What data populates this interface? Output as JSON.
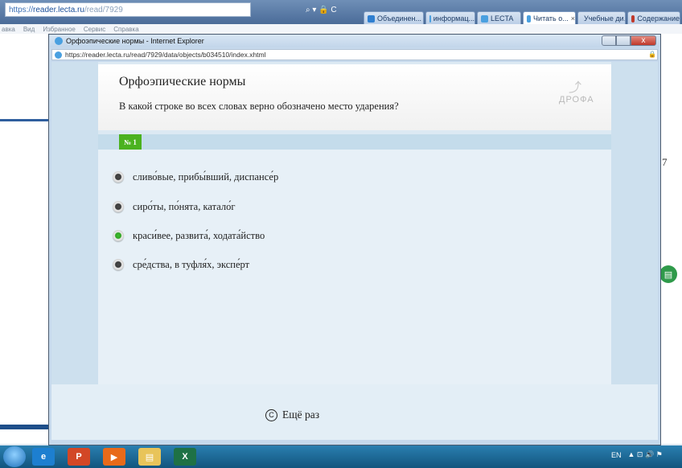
{
  "browser": {
    "address_host": "https://",
    "address_domain": "reader.lecta.ru",
    "address_path": "/read/7929",
    "address_ctrls": "⌕ ▾ 🔒 C",
    "tabs": [
      {
        "label": "Объединен...",
        "color": "#2f7fd0"
      },
      {
        "label": "информац...",
        "color": "#4aa0e0"
      },
      {
        "label": "LECTA",
        "color": "#4aa0e0"
      },
      {
        "label": "Читать о...",
        "color": "#4aa0e0",
        "active": true
      },
      {
        "label": "Учебные ди...",
        "color": "#c0392b"
      },
      {
        "label": "Содержание",
        "color": "#c0392b"
      }
    ],
    "menu": [
      "авка",
      "Вид",
      "Избранное",
      "Сервис",
      "Справка"
    ],
    "tab_close": "×",
    "right_partial_text": "7"
  },
  "popup": {
    "window_title": "Орфоэпические нормы - Internet Explorer",
    "close_glyph": "x",
    "url": "https://reader.lecta.ru/read/7929/data/objects/b034510/index.xhtml",
    "lock": "🔒"
  },
  "quiz": {
    "title": "Орфоэпические нормы",
    "question": "В какой строке во всех словах верно обозначено место ударения?",
    "logo_text": "ДРОФА",
    "number_label": "№ 1",
    "answers": [
      {
        "text": "сливо́вые, прибы́вший, диспансе́р",
        "state": "default"
      },
      {
        "text": "сиро́ты, по́нята, катало́г",
        "state": "default"
      },
      {
        "text": "краси́вее, развита́, ходата́йство",
        "state": "correct"
      },
      {
        "text": "сре́дства, в туфля́х, экспе́рт",
        "state": "default"
      }
    ],
    "retry_glyph": "C",
    "retry_label": "Ещё раз"
  },
  "taskbar": {
    "lang": "EN",
    "tray_icons": "▲ ⊡ 🔊 ⚑",
    "apps": [
      {
        "name": "ie",
        "glyph": "e",
        "color": "#1d7fd0"
      },
      {
        "name": "powerpoint",
        "glyph": "P",
        "color": "#d24726"
      },
      {
        "name": "media",
        "glyph": "▶",
        "color": "#e86a1a"
      },
      {
        "name": "explorer",
        "glyph": "▤",
        "color": "#e8c45a"
      },
      {
        "name": "excel",
        "glyph": "X",
        "color": "#1e7145"
      }
    ]
  }
}
